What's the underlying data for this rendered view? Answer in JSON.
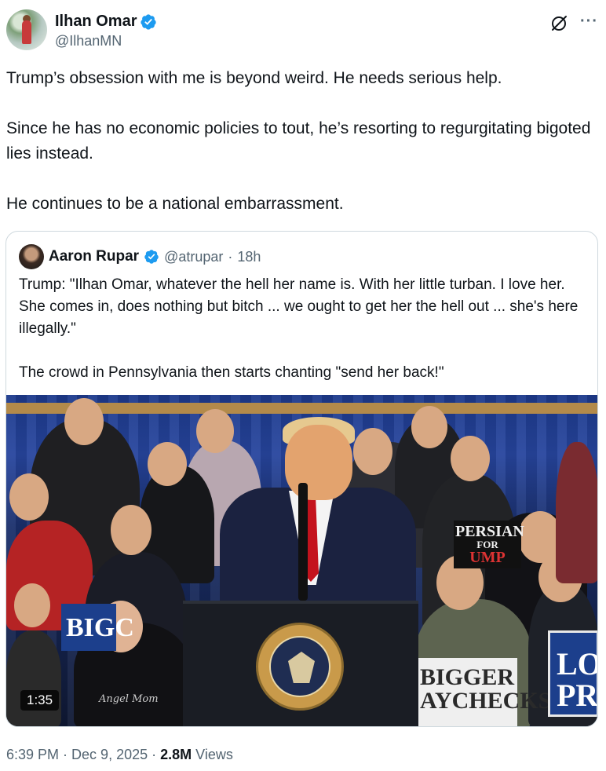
{
  "author": {
    "display_name": "Ilhan Omar",
    "handle": "@IlhanMN",
    "verified": true
  },
  "tweet": {
    "paragraphs": [
      "Trump’s obsession with me is beyond weird. He needs serious help.",
      "Since he has no economic policies to tout, he’s resorting to regurgitating bigoted lies instead.",
      "He continues to be a national embarrassment."
    ]
  },
  "quote": {
    "display_name": "Aaron Rupar",
    "handle": "@atrupar",
    "separator": "·",
    "age": "18h",
    "paragraphs": [
      "Trump: \"Ilhan Omar, whatever the hell her name is. With her little turban. I love her. She comes in, does nothing but bitch ... we ought to get her the hell out ... she's here illegally.\"",
      "The crowd in Pennsylvania then starts chanting \"send her back!\""
    ],
    "video": {
      "duration": "1:35",
      "sign_text": {
        "bigger": "BIGGER",
        "paychecks": "AYCHECKS",
        "persian_1": "PERSIAN",
        "persian_2": "FOR",
        "persian_3": "UMP",
        "blue_left": "BIGC",
        "blue_right_1": "LO",
        "blue_right_2": "PR",
        "shirt": "Angel Mom"
      }
    }
  },
  "meta": {
    "time": "6:39 PM",
    "separator": "·",
    "date": "Dec 9, 2025",
    "views_count": "2.8M",
    "views_label": "Views"
  },
  "colors": {
    "verified_blue": "#1d9bf0",
    "secondary_text": "#536471",
    "border": "#cfd9de"
  },
  "icons": {
    "verified": "verified-badge-icon",
    "grok": "grok-icon",
    "more": "more-icon"
  }
}
